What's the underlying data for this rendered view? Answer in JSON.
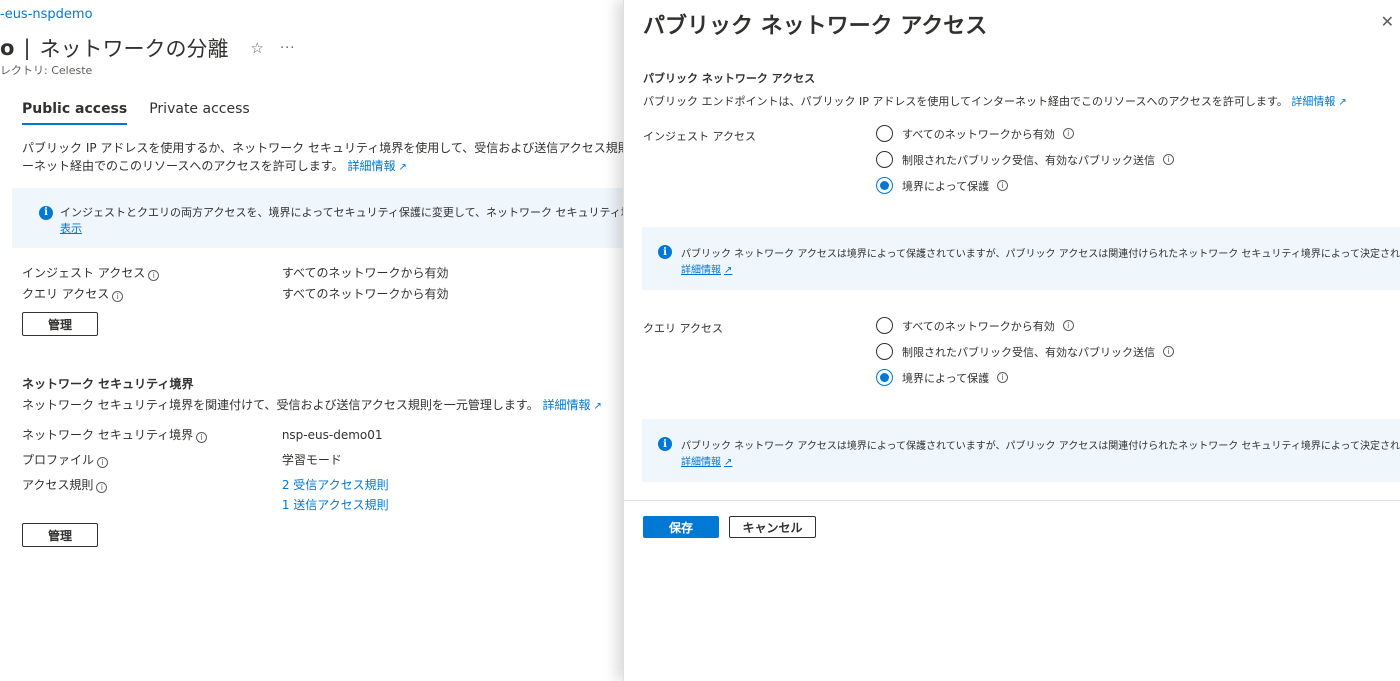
{
  "left_page": {
    "breadcrumb": "-eus-nspdemo",
    "title_resource": "o",
    "title_separator": "|",
    "title_page": "ネットワークの分離",
    "star_glyph": "☆",
    "more_glyph": "···",
    "subtitle": "レクトリ: Celeste",
    "tabs": [
      {
        "label": "Public access",
        "active": true
      },
      {
        "label": "Private access",
        "active": false
      }
    ],
    "description_line1": "パブリック IP アドレスを使用するか、ネットワーク セキュリティ境界を使用して、受信および送信アクセス規則を一元的に管理する",
    "description_line2": "ーネット経由でのこのリソースへのアクセスを許可します。",
    "description_link": "詳細情報",
    "info_text": "インジェストとクエリの両方アクセスを、境界によってセキュリティ保護に変更して、ネットワーク セキュリティ境界の制限を適用します。",
    "info_link": "表示",
    "ingest_label": "インジェスト アクセス",
    "ingest_value": "すべてのネットワークから有効",
    "query_label": "クエリ アクセス",
    "query_value": "すべてのネットワークから有効",
    "manage_label": "管理",
    "nsp_heading": "ネットワーク セキュリティ境界",
    "nsp_description": "ネットワーク セキュリティ境界を関連付けて、受信および送信アクセス規則を一元管理します。",
    "nsp_description_link": "詳細情報",
    "nsp_label": "ネットワーク セキュリティ境界",
    "nsp_value": "nsp-eus-demo01",
    "profile_label": "プロファイル",
    "profile_value": "学習モード",
    "access_rules_label": "アクセス規則",
    "inbound_rules": "2 受信アクセス規則",
    "outbound_rules": "1 送信アクセス規則",
    "manage2_label": "管理"
  },
  "panel": {
    "title": "パブリック ネットワーク アクセス",
    "close_glyph": "✕",
    "section_heading": "パブリック ネットワーク アクセス",
    "section_description": "パブリック エンドポイントは、パブリック IP アドレスを使用してインターネット経由でこのリソースへのアクセスを許可します。",
    "section_link": "詳細情報",
    "ingest": {
      "label": "インジェスト アクセス",
      "options": [
        {
          "label": "すべてのネットワークから有効",
          "selected": false
        },
        {
          "label": "制限されたパブリック受信、有効なパブリック送信",
          "selected": false
        },
        {
          "label": "境界によって保護",
          "selected": true
        }
      ],
      "info_text": "パブリック ネットワーク アクセスは境界によって保護されていますが、パブリック アクセスは関連付けられたネットワーク セキュリティ境界によって決定されます。",
      "info_link": "詳細情報"
    },
    "query": {
      "label": "クエリ アクセス",
      "options": [
        {
          "label": "すべてのネットワークから有効",
          "selected": false
        },
        {
          "label": "制限されたパブリック受信、有効なパブリック送信",
          "selected": false
        },
        {
          "label": "境界によって保護",
          "selected": true
        }
      ],
      "info_text": "パブリック ネットワーク アクセスは境界によって保護されていますが、パブリック アクセスは関連付けられたネットワーク セキュリティ境界によって決定されます。",
      "info_link": "詳細情報"
    },
    "save_label": "保存",
    "cancel_label": "キャンセル"
  },
  "icons": {
    "info": "i",
    "question": "i",
    "external": "↗"
  },
  "colors": {
    "accent": "#0078d4",
    "info_bg": "#eff6fc",
    "text": "#323130"
  }
}
